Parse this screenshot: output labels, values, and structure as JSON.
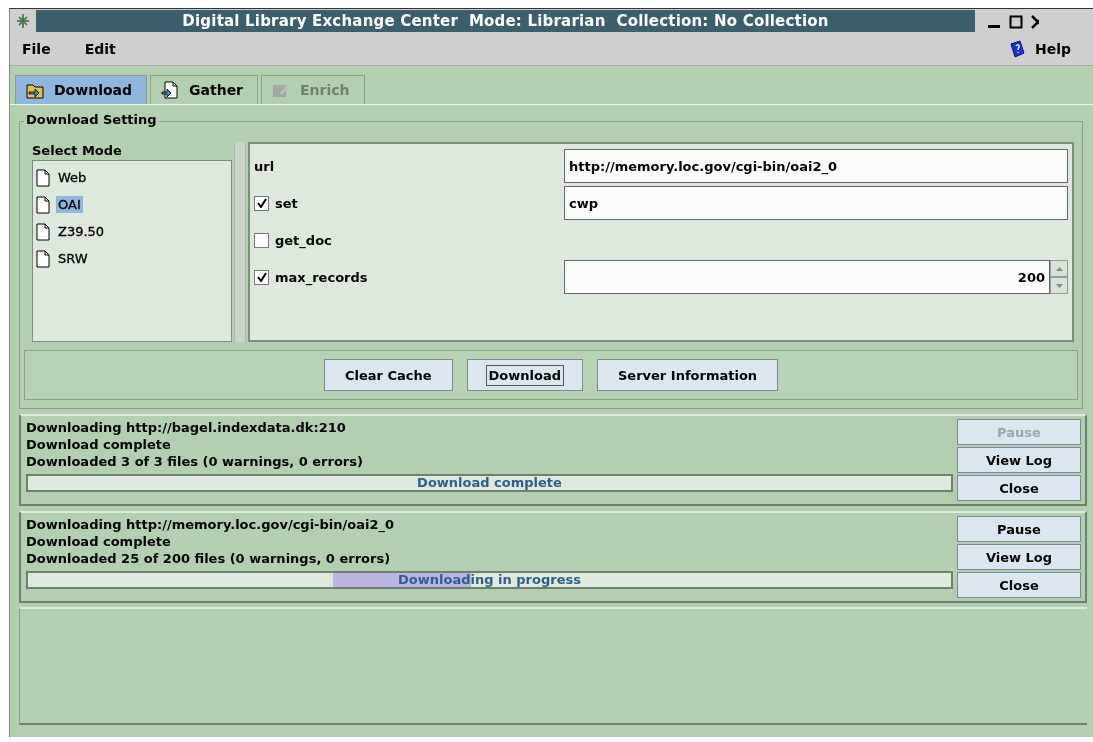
{
  "window": {
    "title": "Digital Library Exchange Center  Mode: Librarian  Collection: No Collection"
  },
  "menu": [
    {
      "label": "File"
    },
    {
      "label": "Edit"
    }
  ],
  "help": {
    "label": "Help"
  },
  "tabs": [
    {
      "label": "Download",
      "selected": true,
      "disabled": false
    },
    {
      "label": "Gather",
      "selected": false,
      "disabled": false
    },
    {
      "label": "Enrich",
      "selected": false,
      "disabled": true
    }
  ],
  "download_setting": {
    "title": "Download Setting",
    "select_mode": {
      "title": "Select Mode",
      "items": [
        {
          "label": "Web",
          "selected": false
        },
        {
          "label": "OAI",
          "selected": true
        },
        {
          "label": "Z39.50",
          "selected": false
        },
        {
          "label": "SRW",
          "selected": false
        }
      ]
    },
    "options": [
      {
        "kind": "text",
        "label": "url",
        "value": "http://memory.loc.gov/cgi-bin/oai2_0"
      },
      {
        "kind": "check",
        "label": "set",
        "checked": true,
        "value": "cwp"
      },
      {
        "kind": "check",
        "label": "get_doc",
        "checked": false
      },
      {
        "kind": "spinner",
        "label": "max_records",
        "checked": true,
        "value": "200"
      }
    ],
    "buttons": [
      {
        "label": "Clear Cache",
        "focused": false
      },
      {
        "label": "Download",
        "focused": true
      },
      {
        "label": "Server Information",
        "focused": false
      }
    ]
  },
  "downloads": [
    {
      "lines": [
        "Downloading http://bagel.indexdata.dk:210",
        "Download complete",
        "Downloaded 3 of 3 files (0 warnings, 0 errors)"
      ],
      "bar_text": "Download complete",
      "busy": false,
      "buttons": [
        {
          "label": "Pause",
          "disabled": true
        },
        {
          "label": "View Log",
          "disabled": false
        },
        {
          "label": "Close",
          "disabled": false
        }
      ]
    },
    {
      "lines": [
        "Downloading http://memory.loc.gov/cgi-bin/oai2_0",
        "Download complete",
        "Downloaded 25 of 200 files (0 warnings, 0 errors)"
      ],
      "bar_text": "Downloading in progress",
      "busy": true,
      "buttons": [
        {
          "label": "Pause",
          "disabled": false
        },
        {
          "label": "View Log",
          "disabled": false
        },
        {
          "label": "Close",
          "disabled": false
        }
      ]
    }
  ]
}
